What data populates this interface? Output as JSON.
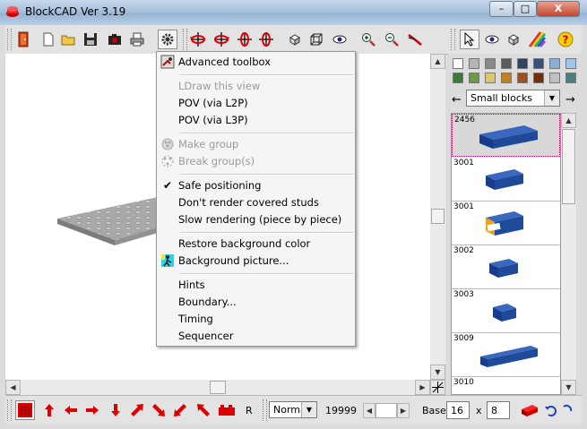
{
  "window": {
    "title": "BlockCAD Ver 3.19"
  },
  "title_controls": {
    "minimize": "–",
    "maximize": "□",
    "close": "X"
  },
  "menu": {
    "items": [
      {
        "label": "Advanced toolbox",
        "enabled": true,
        "icon": "advanced-toolbox-icon"
      },
      {
        "label": "LDraw this view",
        "enabled": false
      },
      {
        "label": "POV (via L2P)",
        "enabled": true
      },
      {
        "label": "POV (via L3P)",
        "enabled": true
      },
      {
        "label": "Make group",
        "enabled": false,
        "icon": "make-group-icon"
      },
      {
        "label": "Break group(s)",
        "enabled": false,
        "icon": "break-group-icon"
      },
      {
        "label": "Safe positioning",
        "enabled": true,
        "checked": true
      },
      {
        "label": "Don't render covered studs",
        "enabled": true
      },
      {
        "label": "Slow rendering (piece by piece)",
        "enabled": true
      },
      {
        "label": "Restore background color",
        "enabled": true
      },
      {
        "label": "Background picture...",
        "enabled": true,
        "icon": "background-picture-icon"
      },
      {
        "label": "Hints",
        "enabled": true
      },
      {
        "label": "Boundary...",
        "enabled": true
      },
      {
        "label": "Timing",
        "enabled": true
      },
      {
        "label": "Sequencer",
        "enabled": true
      }
    ]
  },
  "palette": {
    "colors": [
      "#ffffff",
      "#b5b5b5",
      "#8a8a8a",
      "#5c5c5c",
      "#2e4460",
      "#3a4e7a",
      "#8ab0d8",
      "#9cc8f0",
      "#3d7a3d",
      "#6a9a4a",
      "#d8c870",
      "#c08020",
      "#a05020",
      "#703010",
      "#c0c0c0",
      "#4a8080"
    ]
  },
  "block_set": {
    "selected": "Small blocks"
  },
  "blocks": [
    {
      "id": "2456"
    },
    {
      "id": "3001"
    },
    {
      "id": "3001"
    },
    {
      "id": "3002"
    },
    {
      "id": "3003"
    },
    {
      "id": "3009"
    },
    {
      "id": "3010"
    }
  ],
  "status": {
    "mode": "Norma",
    "count": "19999",
    "base_label": "Base:",
    "base_x": "16",
    "x_label": "x",
    "base_y": "8",
    "rotate_label": "R"
  },
  "colors": {
    "accent_red": "#cc0000",
    "block_blue": "#1f4a9a",
    "baseplate_gray": "#a8a8a8"
  }
}
